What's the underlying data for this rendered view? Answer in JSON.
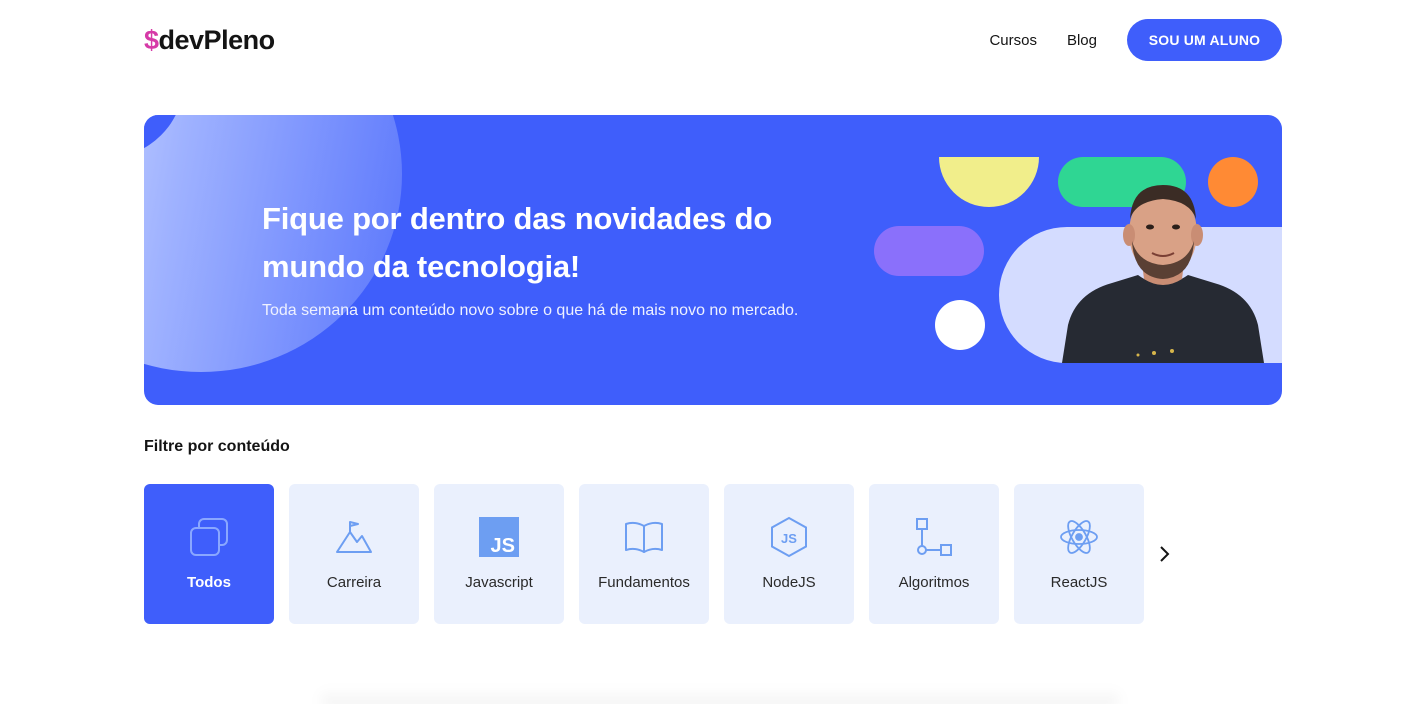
{
  "brand": {
    "logo_symbol": "$",
    "logo_text": "devPleno",
    "symbol_color": "#d63aa7"
  },
  "nav": {
    "links": [
      "Cursos",
      "Blog"
    ],
    "cta_label": "SOU UM ALUNO"
  },
  "banner": {
    "title": "Fique por dentro das novidades do mundo da tecnologia!",
    "subtitle": "Toda semana um conteúdo novo sobre o que há de mais novo no mercado.",
    "background": "#3f5efb"
  },
  "filter": {
    "title": "Filtre por conteúdo",
    "categories": [
      {
        "label": "Todos",
        "icon": "stack-icon",
        "active": true
      },
      {
        "label": "Carreira",
        "icon": "mountain-flag-icon",
        "active": false
      },
      {
        "label": "Javascript",
        "icon": "js-icon",
        "active": false
      },
      {
        "label": "Fundamentos",
        "icon": "book-icon",
        "active": false
      },
      {
        "label": "NodeJS",
        "icon": "nodejs-icon",
        "active": false
      },
      {
        "label": "Algoritmos",
        "icon": "flowchart-icon",
        "active": false
      },
      {
        "label": "ReactJS",
        "icon": "react-icon",
        "active": false
      }
    ],
    "next_icon": "chevron-right-icon"
  },
  "colors": {
    "accent": "#3f5efb",
    "card_bg": "#eaf0fd",
    "icon_stroke": "#6d9ef2"
  }
}
